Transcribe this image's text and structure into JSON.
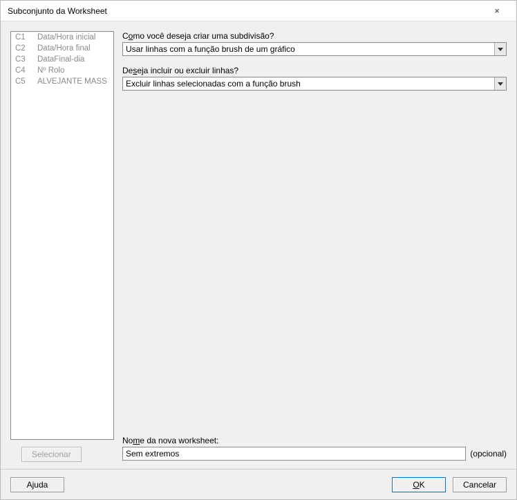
{
  "window": {
    "title": "Subconjunto da Worksheet",
    "close_icon": "×"
  },
  "columns": [
    {
      "id": "C1",
      "name": "Data/Hora inicial"
    },
    {
      "id": "C2",
      "name": "Data/Hora final"
    },
    {
      "id": "C3",
      "name": "DataFinal-dia"
    },
    {
      "id": "C4",
      "name": "Nº Rolo"
    },
    {
      "id": "C5",
      "name": "ALVEJANTE MASS"
    }
  ],
  "select_button": "Selecionar",
  "fields": {
    "how_label_pre": "C",
    "how_label_u": "o",
    "how_label_post": "mo você deseja criar uma subdivisão?",
    "how_value": "Usar linhas com a função brush de um gráfico",
    "include_label_pre": "De",
    "include_label_u": "s",
    "include_label_post": "eja incluir ou excluir linhas?",
    "include_value": "Excluir linhas selecionadas com a função brush",
    "name_label_pre": "No",
    "name_label_u": "m",
    "name_label_post": "e da nova worksheet:",
    "name_value": "Sem extremos",
    "optional_label": "(opcional)"
  },
  "footer": {
    "help": "Ajuda",
    "ok_u": "O",
    "ok_post": "K",
    "cancel": "Cancelar"
  }
}
